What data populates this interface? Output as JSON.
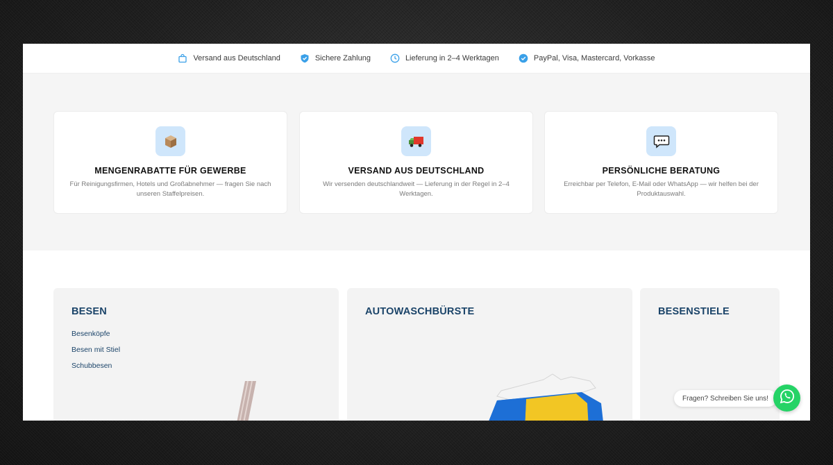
{
  "trustbar": {
    "items": [
      {
        "icon": "bag-icon",
        "label": "Versand aus Deutschland"
      },
      {
        "icon": "shield-check-icon",
        "label": "Sichere Zahlung"
      },
      {
        "icon": "clock-icon",
        "label": "Lieferung in 2–4 Werktagen"
      },
      {
        "icon": "check-circle-icon",
        "label": "PayPal, Visa, Mastercard, Vorkasse"
      }
    ]
  },
  "features": [
    {
      "icon": "box-icon",
      "title": "MENGENRABATTE FÜR GEWERBE",
      "description": "Für Reinigungsfirmen, Hotels und Großabnehmer — fragen Sie nach unseren Staffelpreisen."
    },
    {
      "icon": "truck-icon",
      "title": "VERSAND AUS DEUTSCHLAND",
      "description": "Wir versenden deutschlandweit — Lieferung in der Regel in 2–4 Werktagen."
    },
    {
      "icon": "chat-icon",
      "title": "PERSÖNLICHE BERATUNG",
      "description": "Erreichbar per Telefon, E-Mail oder WhatsApp — wir helfen bei der Produktauswahl."
    }
  ],
  "categories": [
    {
      "title": "BESEN",
      "links": [
        "Besenköpfe",
        "Besen mit Stiel",
        "Schubbesen"
      ]
    },
    {
      "title": "AUTOWASCHBÜRSTE",
      "links": []
    },
    {
      "title": "BESENSTIELE",
      "links": []
    }
  ],
  "whatsapp": {
    "bubble_text": "Fragen? Schreiben Sie uns!",
    "icon": "whatsapp-icon"
  },
  "colors": {
    "accent_blue": "#3aa0e8",
    "heading_navy": "#1b4469",
    "whatsapp_green": "#25d366"
  }
}
